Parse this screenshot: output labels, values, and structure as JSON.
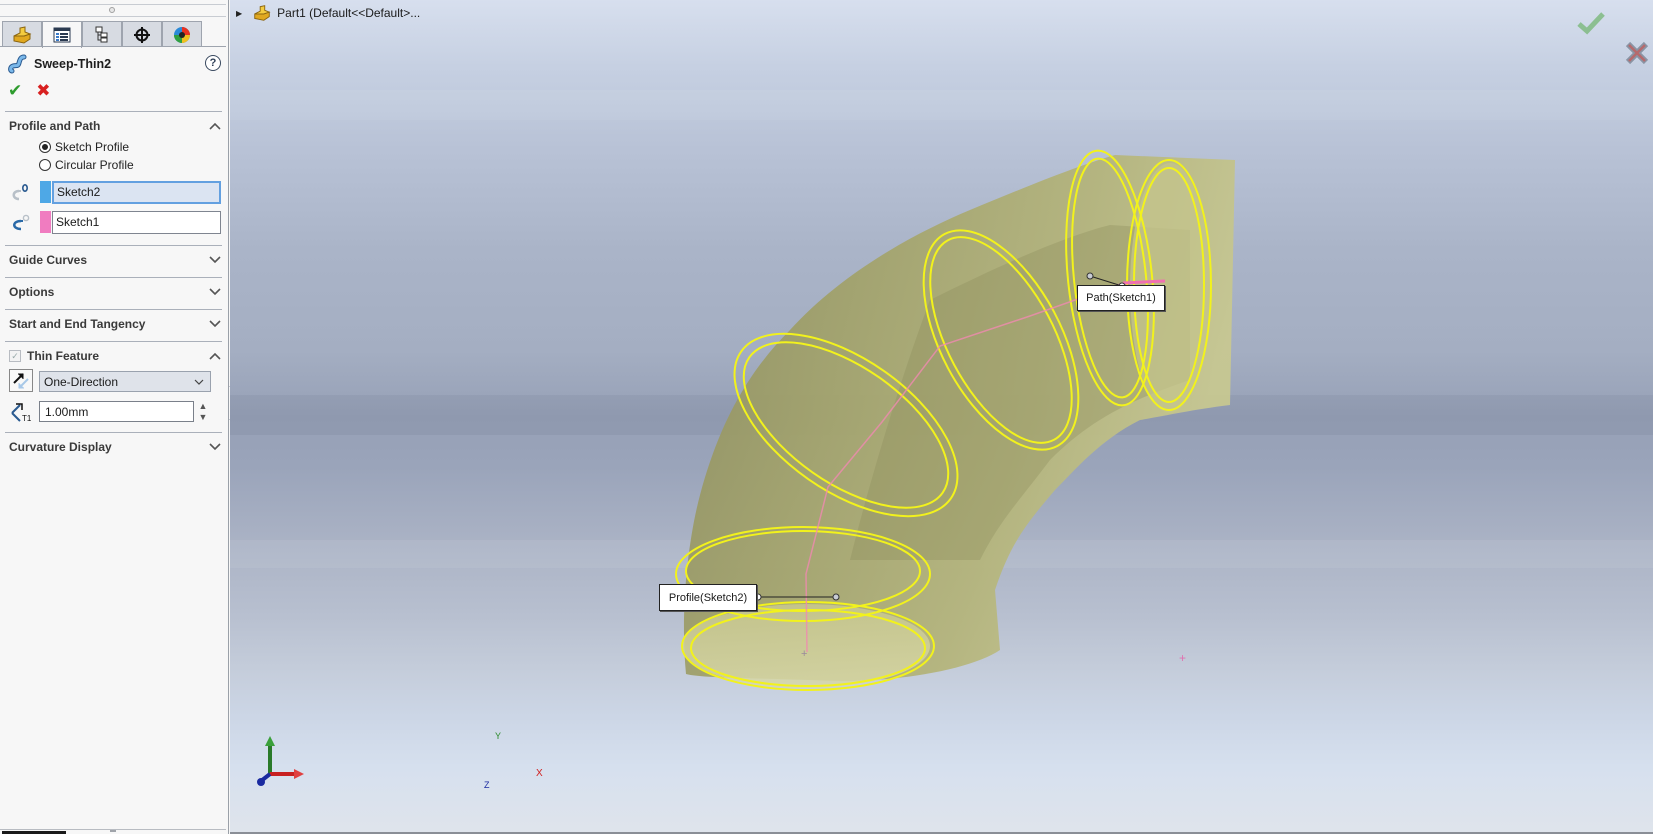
{
  "panel": {
    "tabs": [
      {
        "name": "feature-manager",
        "icon": "part-icon"
      },
      {
        "name": "property-manager",
        "icon": "property-manager-icon",
        "active": true
      },
      {
        "name": "configuration-manager",
        "icon": "configuration-icon"
      },
      {
        "name": "dimxpert-manager",
        "icon": "crosshair-icon"
      },
      {
        "name": "display-manager",
        "icon": "appearance-ball-icon"
      }
    ],
    "title": "Sweep-Thin2",
    "help_label": "?",
    "ok_label": "✔",
    "cancel_label": "✖",
    "groups": {
      "profile_and_path": {
        "label": "Profile and Path",
        "expanded": true,
        "options": [
          {
            "label": "Sketch Profile",
            "selected": true
          },
          {
            "label": "Circular Profile",
            "selected": false
          }
        ],
        "profile": {
          "value": "Sketch2",
          "color": "#4ea8e6",
          "icon": "profile-icon"
        },
        "path": {
          "value": "Sketch1",
          "color": "#f07cc0",
          "icon": "path-icon"
        }
      },
      "guide_curves": {
        "label": "Guide Curves",
        "expanded": false
      },
      "options": {
        "label": "Options",
        "expanded": false
      },
      "tangency": {
        "label": "Start and End Tangency",
        "expanded": false
      },
      "thin_feature": {
        "label": "Thin Feature",
        "checked": true,
        "expanded": true,
        "type": "One-Direction",
        "thickness": "1.00mm"
      },
      "curvature": {
        "label": "Curvature Display",
        "expanded": false
      }
    }
  },
  "viewport": {
    "tree_label": "Part1  (Default<<Default>...",
    "callouts": {
      "path": "Path(Sketch1)",
      "profile": "Profile(Sketch2)"
    },
    "triad": {
      "x": "X",
      "y": "Y",
      "z": "Z"
    },
    "colors": {
      "body": "#a8a86e",
      "edge_highlight": "#f0f020",
      "path": "#f08ab0",
      "ok": "#6aa86a",
      "cancel": "#c05050"
    }
  }
}
